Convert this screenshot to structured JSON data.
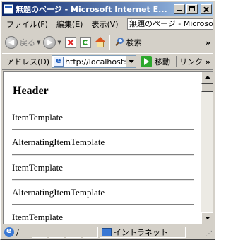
{
  "window": {
    "title": "無題のページ - Microsoft Internet E..."
  },
  "menubar": {
    "items": [
      "ファイル(F)",
      "編集(E)",
      "表示(V)"
    ],
    "title_field": "無題のページ - Microsoft"
  },
  "toolbar": {
    "back_label": "戻る",
    "search_label": "検索"
  },
  "addressbar": {
    "label": "アドレス(D)",
    "url": "http://localhost:",
    "go_label": "移動",
    "links_label": "リンク"
  },
  "content": {
    "header": "Header",
    "rows": [
      "ItemTemplate",
      "AlternatingItemTemplate",
      "ItemTemplate",
      "AlternatingItemTemplate",
      "ItemTemplate"
    ]
  },
  "statusbar": {
    "text": "/",
    "zone": "イントラネット"
  }
}
